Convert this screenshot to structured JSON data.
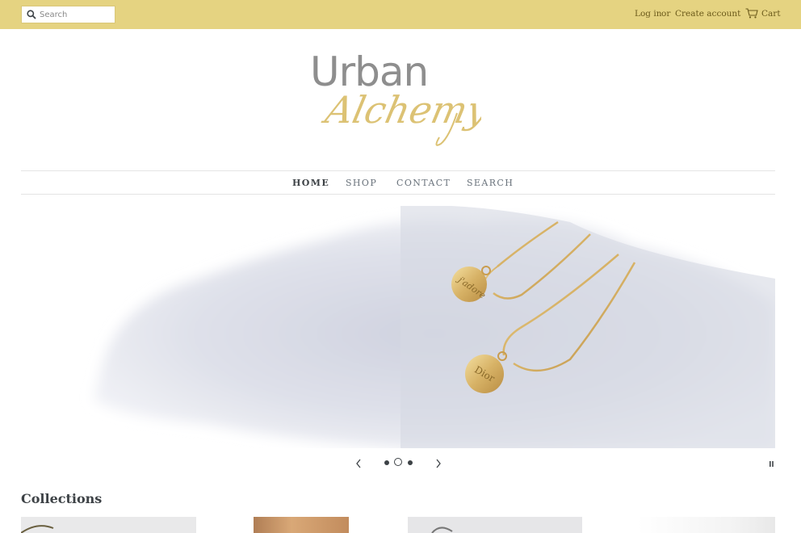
{
  "header": {
    "search_placeholder": "Search",
    "login_label": "Log in",
    "or_label": "or",
    "create_account_label": "Create account",
    "cart_label": "Cart"
  },
  "logo": {
    "word1": "Urban",
    "word2": "Alchemy"
  },
  "nav": {
    "items": [
      {
        "label": "HOME",
        "active": true
      },
      {
        "label": "SHOP",
        "active": false
      },
      {
        "label": "CONTACT",
        "active": false
      },
      {
        "label": "SEARCH",
        "active": false
      }
    ]
  },
  "slideshow": {
    "slide_count": 3,
    "active_index": 1,
    "pendant_labels": [
      "j'adore",
      "Dior"
    ]
  },
  "collections": {
    "title": "Collections"
  },
  "colors": {
    "topbar": "#e5d381",
    "text": "#3d4246",
    "gold": "#d9bf72"
  }
}
